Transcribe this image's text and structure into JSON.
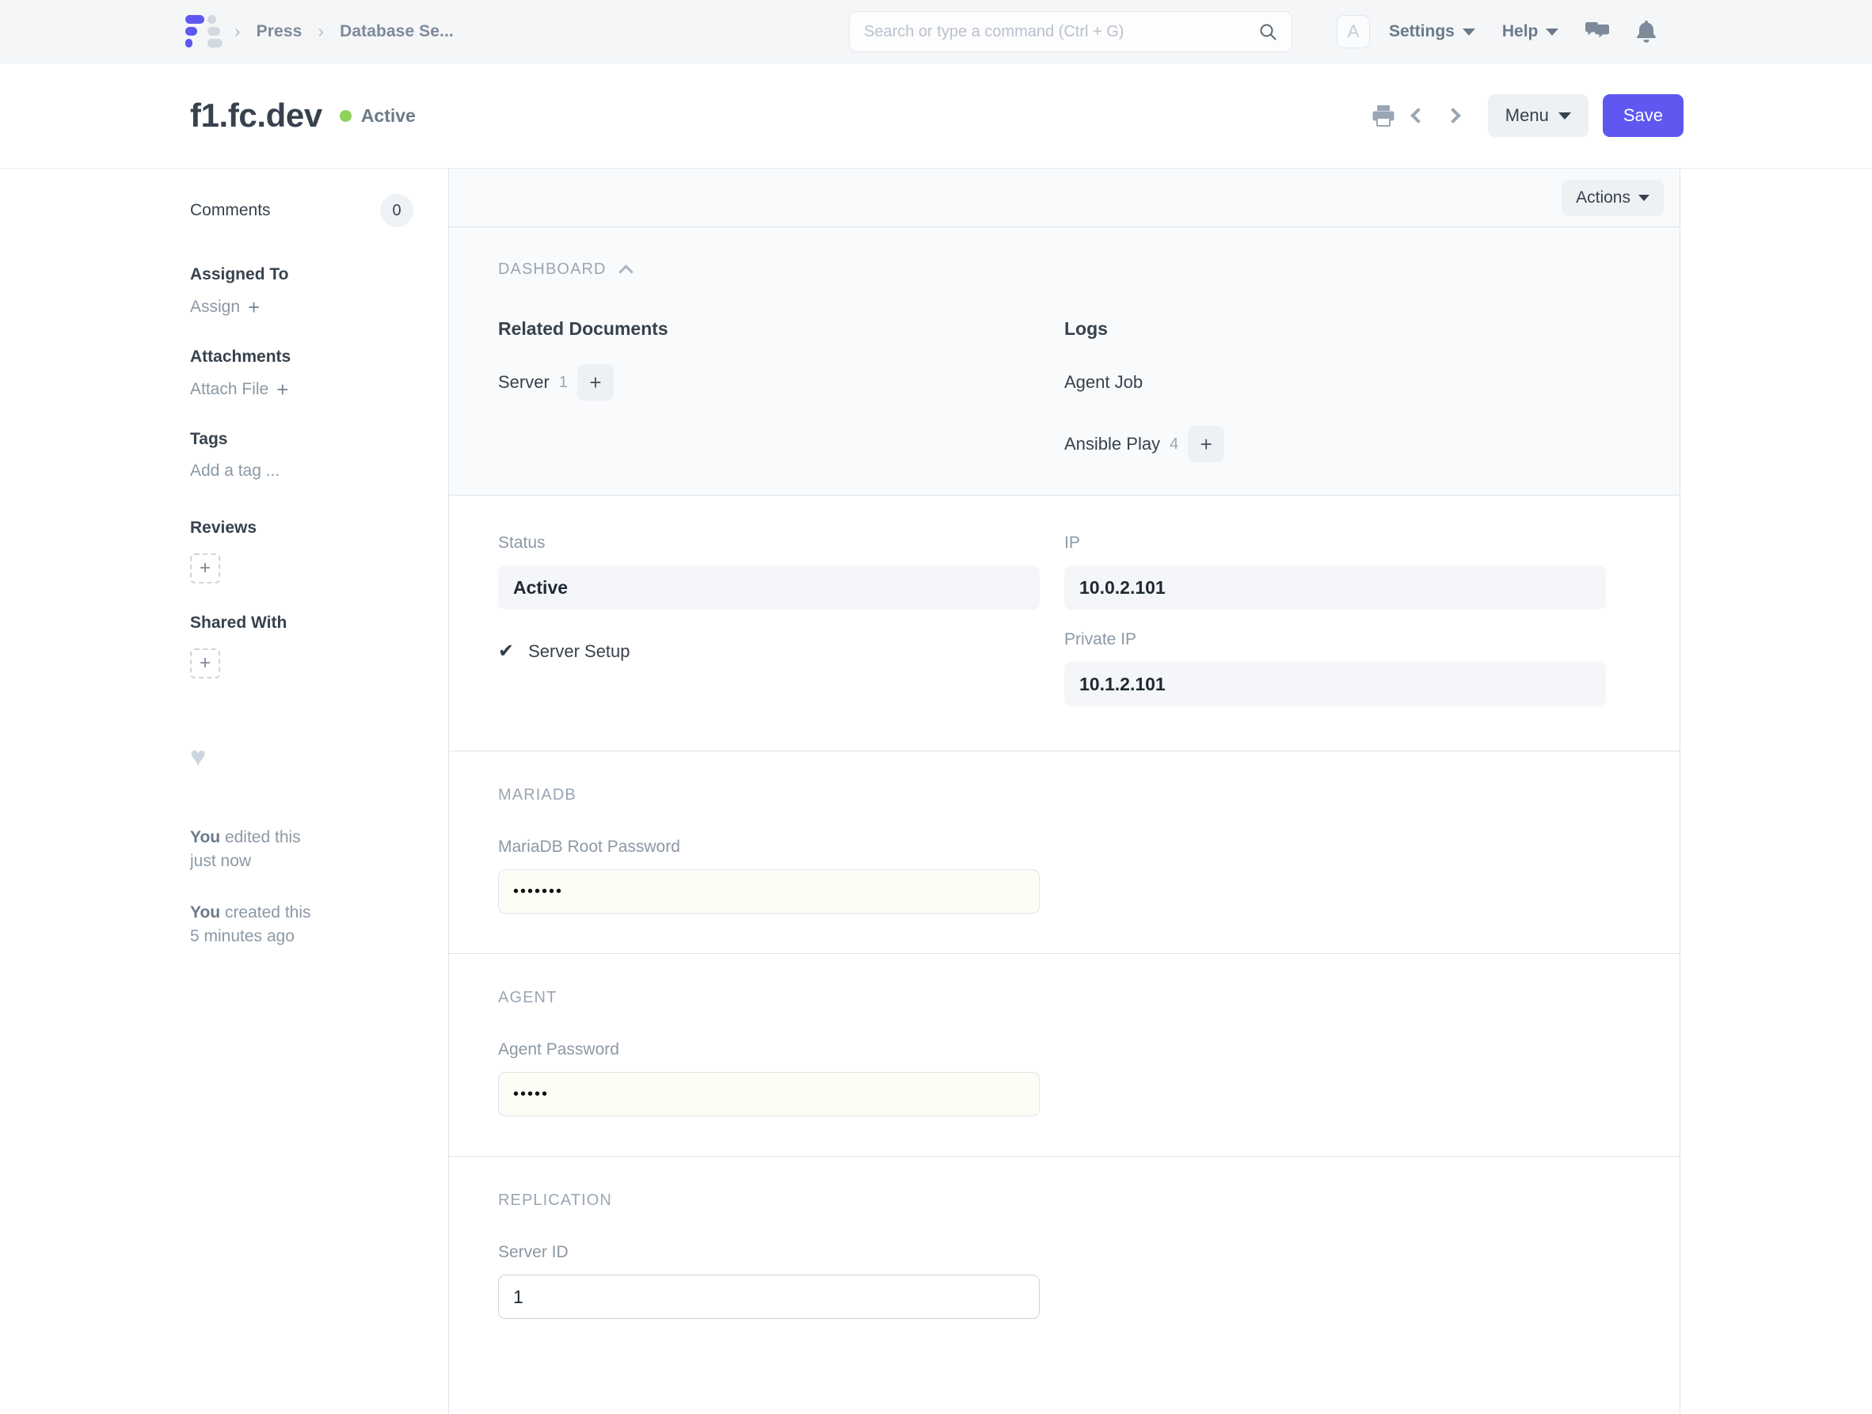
{
  "navbar": {
    "breadcrumbs": [
      {
        "label": "Press"
      },
      {
        "label": "Database Se..."
      }
    ],
    "search": {
      "value": "",
      "placeholder": "Search or type a command (Ctrl + G)"
    },
    "avatar_letter": "A",
    "settings_label": "Settings",
    "help_label": "Help"
  },
  "pagehead": {
    "title": "f1.fc.dev",
    "status": "Active",
    "status_color": "#8ed25c",
    "menu_label": "Menu",
    "save_label": "Save",
    "primary_color": "#5e58f0"
  },
  "sidebar": {
    "comments_label": "Comments",
    "comments_count": "0",
    "assigned_to_label": "Assigned To",
    "assign_label": "Assign",
    "attachments_label": "Attachments",
    "attach_file_label": "Attach File",
    "tags_label": "Tags",
    "add_tag_label": "Add a tag ...",
    "reviews_label": "Reviews",
    "shared_with_label": "Shared With",
    "plus_glyph": "+",
    "heart_glyph": "♥",
    "activity": [
      {
        "actor": "You",
        "text": " edited this",
        "time": "just now"
      },
      {
        "actor": "You",
        "text": " created this",
        "time": "5 minutes ago"
      }
    ]
  },
  "main": {
    "actions_label": "Actions",
    "dashboard": {
      "section_label": "DASHBOARD",
      "columns": [
        {
          "title": "Related Documents",
          "items": [
            {
              "name": "Server",
              "count": "1",
              "has_add": true
            }
          ]
        },
        {
          "title": "Logs",
          "items": [
            {
              "name": "Agent Job",
              "count": "",
              "has_add": false
            },
            {
              "name": "Ansible Play",
              "count": "4",
              "has_add": true
            }
          ]
        }
      ]
    },
    "status_section": {
      "status_label": "Status",
      "status_value": "Active",
      "server_setup_label": "Server Setup",
      "server_setup_checked": true,
      "ip_label": "IP",
      "ip_value": "10.0.2.101",
      "private_ip_label": "Private IP",
      "private_ip_value": "10.1.2.101"
    },
    "mariadb_section": {
      "section_label": "MARIADB",
      "root_password_label": "MariaDB Root Password",
      "root_password_value": "•••••••"
    },
    "agent_section": {
      "section_label": "AGENT",
      "agent_password_label": "Agent Password",
      "agent_password_value": "•••••"
    },
    "replication_section": {
      "section_label": "REPLICATION",
      "server_id_label": "Server ID",
      "server_id_value": "1"
    }
  }
}
